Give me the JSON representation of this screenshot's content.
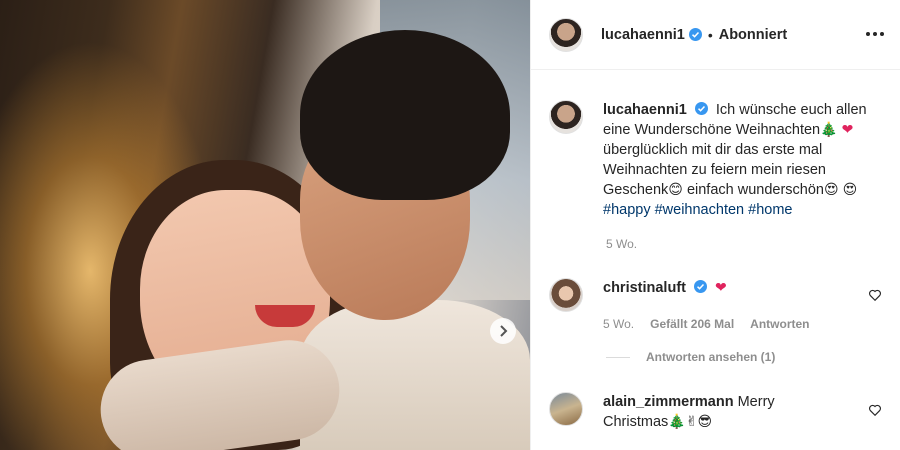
{
  "post": {
    "author": "lucahaenni1",
    "follow_status": "Abonniert",
    "separator": "•",
    "caption_plain_1": "Ich wünsche euch allen eine Wunderschöne Weihnachten",
    "caption_plain_2": "überglücklich mit dir das erste mal Weihnachten zu feiern mein riesen Geschenk",
    "caption_plain_3": "einfach wunderschön",
    "hashtags": [
      "#happy",
      "#weihnachten",
      "#home"
    ],
    "time": "5 Wo."
  },
  "emoji": {
    "tree": "🎄",
    "heart": "❤",
    "smile": "😊",
    "heart_eyes": "😍",
    "victory": "✌",
    "cool": "😎"
  },
  "comments": [
    {
      "author": "christinaluft",
      "time": "5 Wo.",
      "likes": "Gefällt 206 Mal",
      "reply": "Antworten",
      "view_replies": "Antworten ansehen (1)"
    },
    {
      "author": "alain_zimmermann",
      "text_1": "Merry",
      "text_2": "Christmas"
    }
  ],
  "colors": {
    "verified": "#3897f0",
    "hashtag": "#00376b",
    "meta": "#8e8e8e"
  }
}
